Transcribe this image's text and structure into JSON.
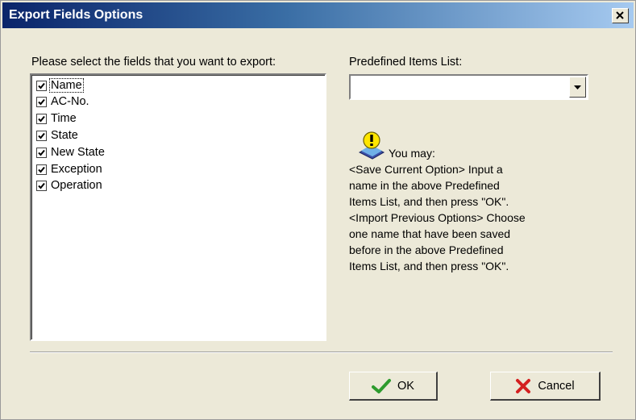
{
  "window": {
    "title": "Export Fields Options"
  },
  "fields_label": "Please select the fields that you want to export:",
  "fields": [
    {
      "label": "Name",
      "checked": true
    },
    {
      "label": "AC-No.",
      "checked": true
    },
    {
      "label": "Time",
      "checked": true
    },
    {
      "label": "State",
      "checked": true
    },
    {
      "label": "New State",
      "checked": true
    },
    {
      "label": "Exception",
      "checked": true
    },
    {
      "label": "Operation",
      "checked": true
    }
  ],
  "predefined": {
    "label": "Predefined Items List:",
    "value": ""
  },
  "help": {
    "first_line": "You may:",
    "lines": [
      "<Save Current Option> Input a",
      "name in the above Predefined",
      "Items List, and then press \"OK\".",
      "<Import Previous Options> Choose",
      "one name that have been saved",
      "before in the above Predefined",
      "Items List, and then press \"OK\"."
    ]
  },
  "buttons": {
    "ok": "OK",
    "cancel": "Cancel"
  },
  "colors": {
    "title_bar": "#0a246a",
    "dialog_bg": "#ece9d8",
    "ok_check": "#2e9b2e",
    "cancel_x": "#d42020"
  },
  "icons": {
    "close": "close-icon",
    "dropdown": "chevron-down-icon",
    "info": "info-icon",
    "ok": "checkmark-icon",
    "cancel": "x-icon"
  }
}
